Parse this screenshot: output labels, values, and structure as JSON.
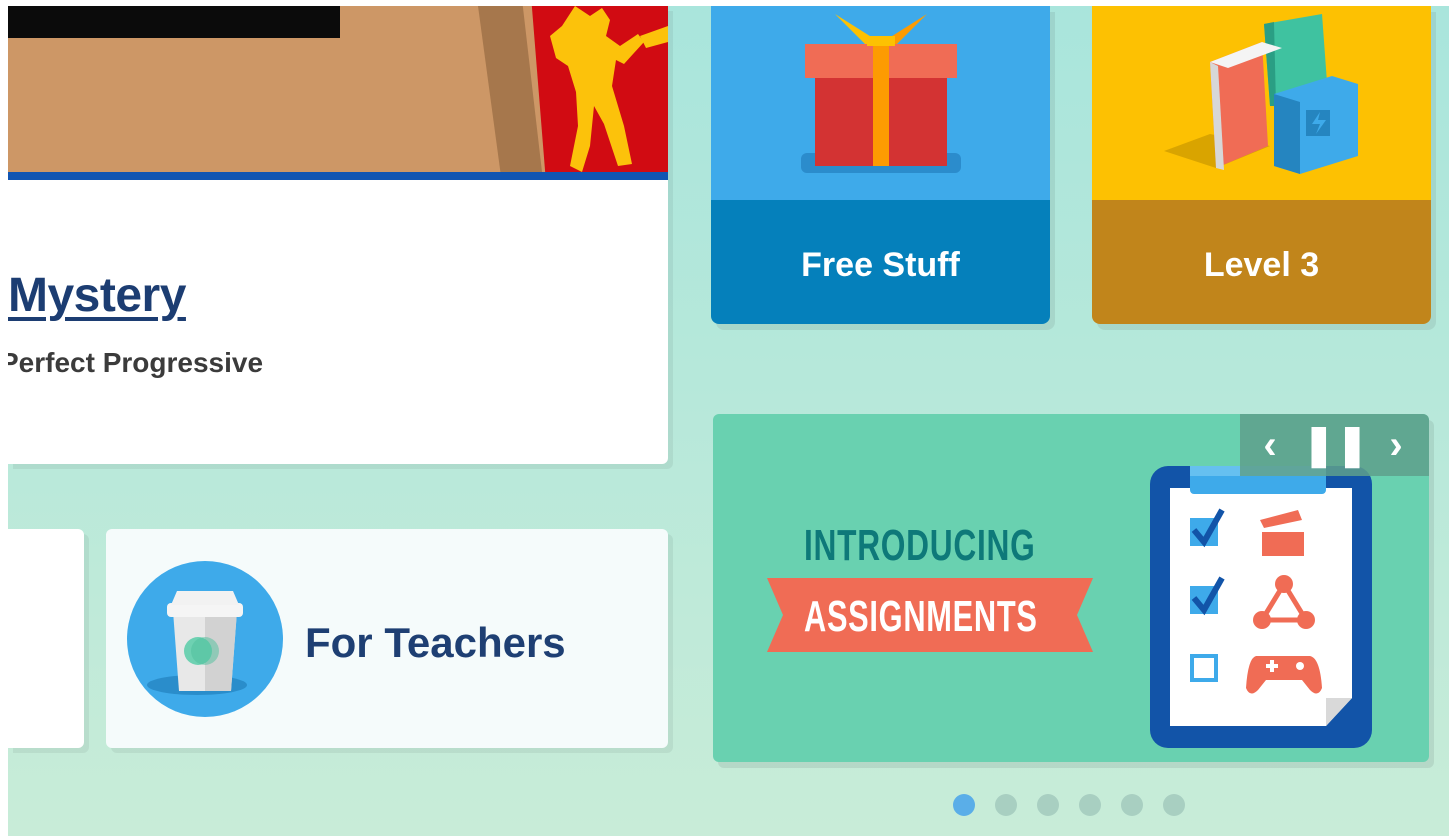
{
  "featured": {
    "title": "Mystery",
    "subtitle": "Perfect Progressive"
  },
  "teachers_card": {
    "label": "For Teachers",
    "icon": "coffee-cup-icon"
  },
  "tiles": [
    {
      "label": "Free Stuff",
      "icon": "gift-icon",
      "color": "#3eaaea",
      "bar_color": "#0580bb"
    },
    {
      "label": "Level 3",
      "icon": "books-icon",
      "color": "#fdc102",
      "bar_color": "#c1851b"
    }
  ],
  "carousel": {
    "heading": "INTRODUCING",
    "ribbon": "ASSIGNMENTS",
    "controls": {
      "prev": "‹",
      "pause": "❚❚",
      "next": "›"
    },
    "slide_count": 6,
    "active_slide": 1
  },
  "colors": {
    "background": "#b6e8da",
    "navy": "#1e3f73",
    "teal": "#69d1b0",
    "coral": "#f06c55"
  }
}
